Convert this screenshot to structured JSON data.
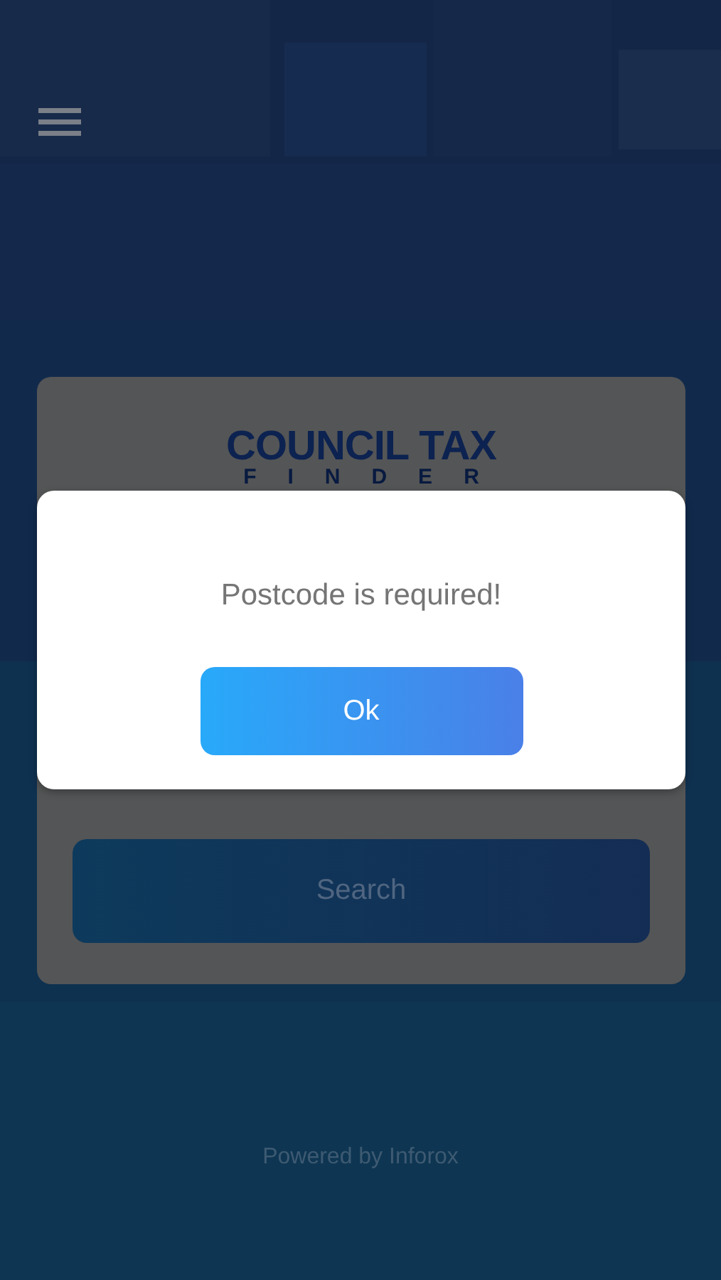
{
  "logo": {
    "title": "COUNCIL TAX",
    "subtitle": "FINDER"
  },
  "search_button": {
    "label": "Search"
  },
  "footer": {
    "text": "Powered by Inforox"
  },
  "dialog": {
    "message": "Postcode is required!",
    "button": "Ok"
  }
}
